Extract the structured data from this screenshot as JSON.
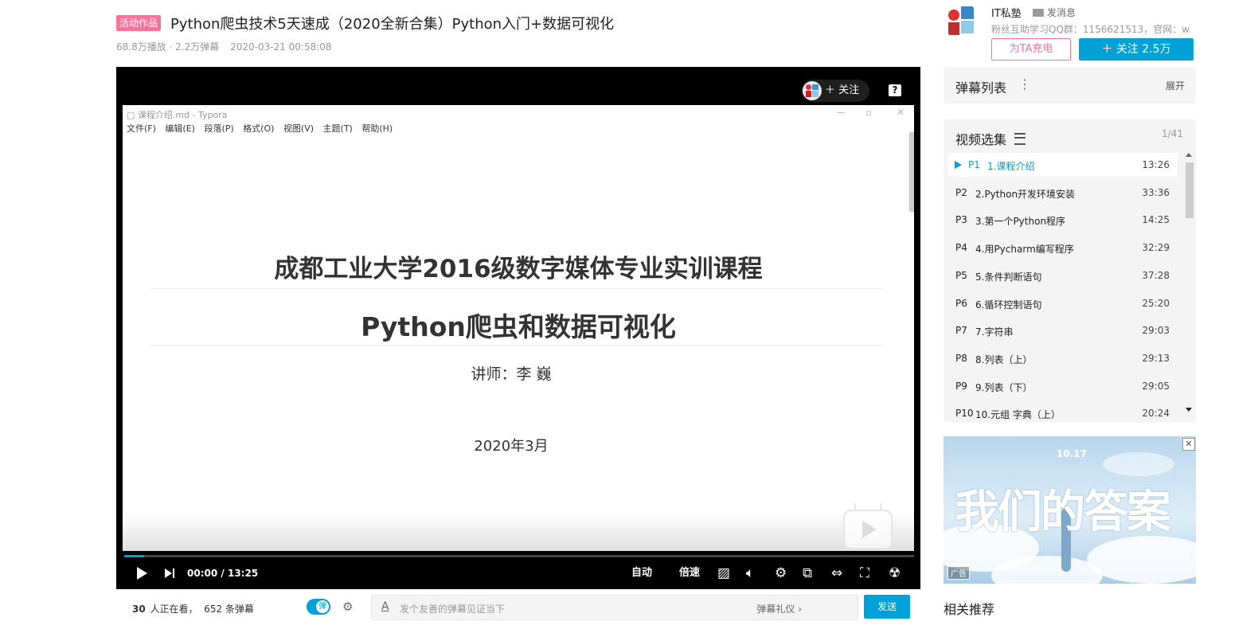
{
  "video": {
    "badge": "活动作品",
    "title": "Python爬虫技术5天速成（2020全新合集）Python入门+数据可视化",
    "views": "68.8万播放 · 2.2万弹幕",
    "date": "2020-03-21 00:58:08"
  },
  "player": {
    "follow_label": "关注",
    "help": "?",
    "typora": {
      "window_title": "课程介绍.md - Typora",
      "window_controls": [
        "—",
        "▫",
        "✕"
      ],
      "menu": [
        "文件(F)",
        "编辑(E)",
        "段落(P)",
        "格式(O)",
        "视图(V)",
        "主题(T)",
        "帮助(H)"
      ]
    },
    "doc": {
      "h1": "成都工业大学2016级数字媒体专业实训课程",
      "h2": "Python爬虫和数据可视化",
      "teacher": "讲师：李  巍",
      "date": "2020年3月"
    },
    "progress_fraction": 0.025,
    "time_current": "00:00",
    "time_sep": "/",
    "time_total": "13:25",
    "quality": "自动",
    "speed": "倍速"
  },
  "below_player": {
    "viewers_count": "30",
    "viewers_text": "人正在看，",
    "danmaku_count": "652 条弹幕",
    "toggle_label": "弹",
    "input_placeholder": "发个友善的弹幕见证当下",
    "etiquette": "弹幕礼仪 ›",
    "send": "发送"
  },
  "uploader": {
    "name": "IT私塾",
    "message": "发消息",
    "description": "粉丝互助学习QQ群：1156621513，官网：w...",
    "charge": "为TA充电",
    "follow": "＋  关注 2.5万"
  },
  "danmaku_list": {
    "title": "弹幕列表",
    "dots": "⋮",
    "expand": "展开"
  },
  "episodes": {
    "title": "视频选集",
    "count": "1/41",
    "items": [
      {
        "num": "P1",
        "name": "1.课程介绍",
        "dur": "13:26"
      },
      {
        "num": "P2",
        "name": "2.Python开发环境安装",
        "dur": "33:36"
      },
      {
        "num": "P3",
        "name": "3.第一个Python程序",
        "dur": "14:25"
      },
      {
        "num": "P4",
        "name": "4.用Pycharm编写程序",
        "dur": "32:29"
      },
      {
        "num": "P5",
        "name": "5.条件判断语句",
        "dur": "37:28"
      },
      {
        "num": "P6",
        "name": "6.循环控制语句",
        "dur": "25:20"
      },
      {
        "num": "P7",
        "name": "7.字符串",
        "dur": "29:03"
      },
      {
        "num": "P8",
        "name": "8.列表（上）",
        "dur": "29:13"
      },
      {
        "num": "P9",
        "name": "9.列表（下）",
        "dur": "29:05"
      },
      {
        "num": "P10",
        "name": "10.元组  字典（上）",
        "dur": "20:24"
      }
    ]
  },
  "ad": {
    "date": "10.17",
    "art_text": "我们的答案",
    "tag": "广告",
    "close": "✕"
  },
  "related": {
    "title": "相关推荐"
  }
}
